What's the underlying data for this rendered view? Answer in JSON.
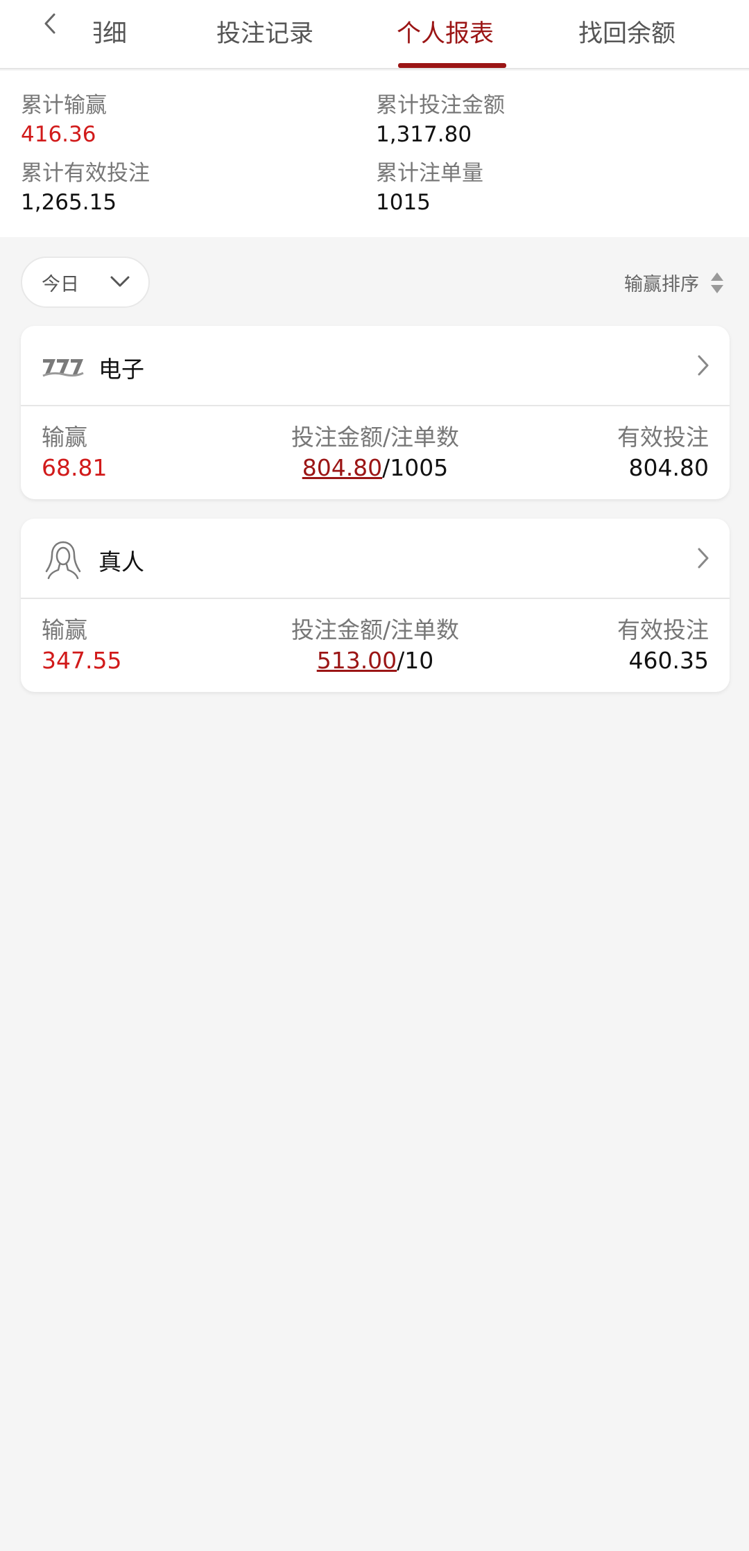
{
  "nav": {
    "tabs": [
      {
        "label": "明细"
      },
      {
        "label": "投注记录"
      },
      {
        "label": "个人报表"
      },
      {
        "label": "找回余额"
      }
    ],
    "active_tab": "个人报表"
  },
  "summary": {
    "cumulative_win_loss": {
      "label": "累计输赢",
      "value": "416.36"
    },
    "cumulative_bet_amount": {
      "label": "累计投注金额",
      "value": "1,317.80"
    },
    "cumulative_valid_bet": {
      "label": "累计有效投注",
      "value": "1,265.15"
    },
    "cumulative_bet_count": {
      "label": "累计注单量",
      "value": "1015"
    }
  },
  "filters": {
    "date_range": {
      "selected": "今日"
    },
    "sort_label": "输赢排序"
  },
  "cards": [
    {
      "title": "电子",
      "icon": "slot-777-icon",
      "win_loss_label": "输赢",
      "win_loss": "68.81",
      "bet_label": "投注金额/注单数",
      "bet_amount": "804.80",
      "bet_count": "/1005",
      "valid_label": "有效投注",
      "valid_bet": "804.80"
    },
    {
      "title": "真人",
      "icon": "live-dealer-icon",
      "win_loss_label": "输赢",
      "win_loss": "347.55",
      "bet_label": "投注金额/注单数",
      "bet_amount": "513.00",
      "bet_count": "/10",
      "valid_label": "有效投注",
      "valid_bet": "460.35"
    }
  ],
  "colors": {
    "accent": "#9b1515",
    "win_red": "#d11a1a",
    "background": "#f5f5f5"
  }
}
